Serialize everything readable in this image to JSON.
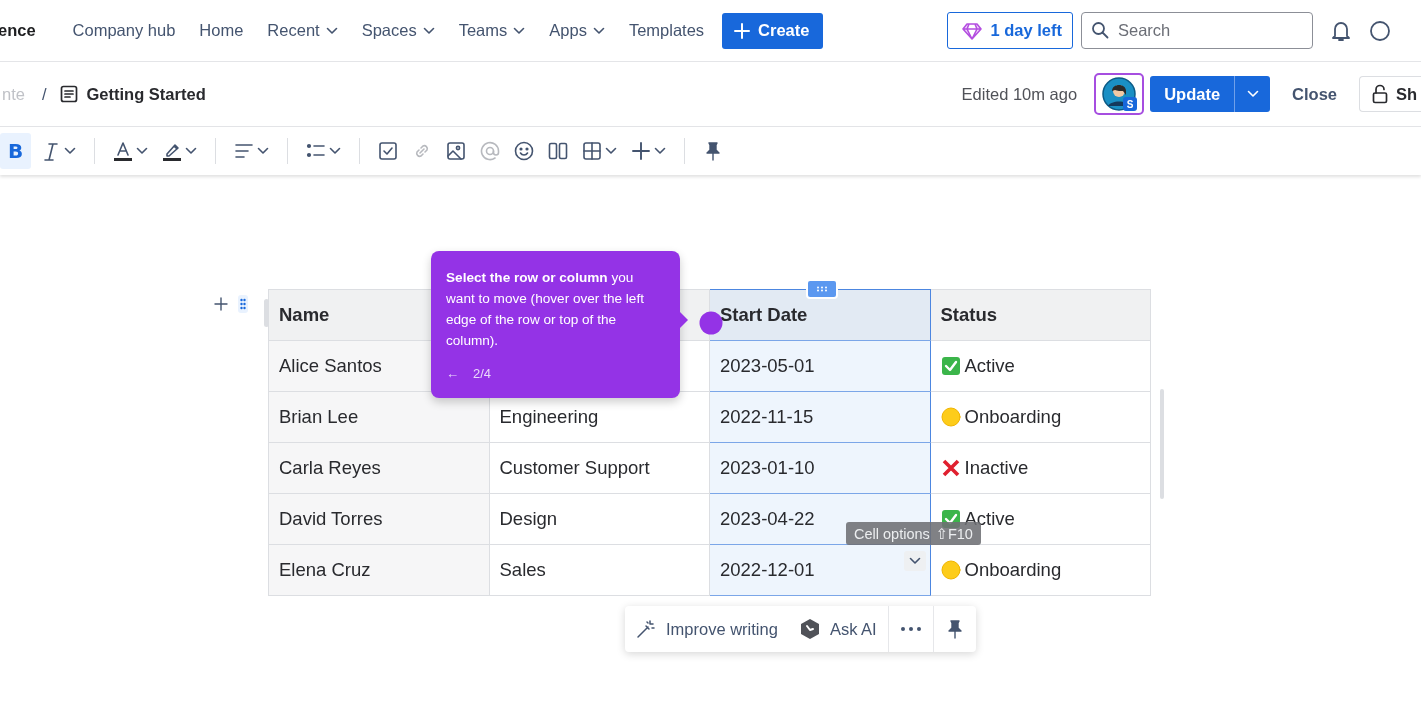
{
  "top_nav": {
    "logo_text": "ence",
    "links": [
      {
        "label": "Company hub",
        "dropdown": false
      },
      {
        "label": "Home",
        "dropdown": false
      },
      {
        "label": "Recent",
        "dropdown": true
      },
      {
        "label": "Spaces",
        "dropdown": true
      },
      {
        "label": "Teams",
        "dropdown": true
      },
      {
        "label": "Apps",
        "dropdown": true
      },
      {
        "label": "Templates",
        "dropdown": false
      }
    ],
    "create_button": "Create",
    "trial_button": "1 day left",
    "search": {
      "placeholder": "Search"
    }
  },
  "page_header": {
    "parent_crumb": "nte",
    "separator": "/",
    "title": "Getting Started",
    "edited": "Edited 10m ago",
    "avatar_badge": "S",
    "update_button": "Update",
    "close_button": "Close",
    "share_button": "Sh"
  },
  "toolbar": [
    {
      "kind": "bold",
      "label": "B",
      "active": true,
      "disabled": false,
      "dropdown": false
    },
    {
      "kind": "italic",
      "active": false,
      "disabled": false,
      "dropdown": true
    },
    {
      "kind": "separator"
    },
    {
      "kind": "text-color",
      "active": false,
      "disabled": false,
      "dropdown": true
    },
    {
      "kind": "highlight",
      "active": false,
      "disabled": false,
      "dropdown": true
    },
    {
      "kind": "separator"
    },
    {
      "kind": "align",
      "active": false,
      "disabled": false,
      "dropdown": true
    },
    {
      "kind": "separator"
    },
    {
      "kind": "list",
      "active": false,
      "disabled": false,
      "dropdown": true
    },
    {
      "kind": "separator"
    },
    {
      "kind": "task",
      "active": false,
      "disabled": false,
      "dropdown": false
    },
    {
      "kind": "link",
      "active": false,
      "disabled": true,
      "dropdown": false
    },
    {
      "kind": "image",
      "active": false,
      "disabled": false,
      "dropdown": false
    },
    {
      "kind": "mention",
      "active": false,
      "disabled": true,
      "dropdown": false
    },
    {
      "kind": "emoji",
      "active": false,
      "disabled": false,
      "dropdown": false
    },
    {
      "kind": "layout",
      "active": false,
      "disabled": false,
      "dropdown": false
    },
    {
      "kind": "table",
      "active": false,
      "disabled": false,
      "dropdown": true
    },
    {
      "kind": "insert",
      "active": false,
      "disabled": false,
      "dropdown": true
    },
    {
      "kind": "separator"
    },
    {
      "kind": "pin",
      "active": false,
      "disabled": false,
      "dropdown": false
    }
  ],
  "table": {
    "columns": [
      {
        "label": "Name",
        "selected": false
      },
      {
        "selected": false
      },
      {
        "label": "Start Date",
        "selected": true
      },
      {
        "label": "Status",
        "selected": false
      }
    ],
    "rows": [
      {
        "name": "Alice Santos",
        "start_date": "2023-05-01",
        "status": {
          "kind": "active",
          "text": "Active"
        },
        "cell_menu": false
      },
      {
        "name": "Brian Lee",
        "column_2": "Engineering",
        "start_date": "2022-11-15",
        "status": {
          "kind": "onboarding",
          "text": "Onboarding"
        },
        "cell_menu": false
      },
      {
        "name": "Carla Reyes",
        "column_2": "Customer Support",
        "start_date": "2023-01-10",
        "status": {
          "kind": "inactive",
          "text": "Inactive"
        },
        "cell_menu": false
      },
      {
        "name": "David Torres",
        "column_2": "Design",
        "start_date": "2023-04-22",
        "status": {
          "kind": "active",
          "text": "Active"
        },
        "cell_menu": false
      },
      {
        "name": "Elena Cruz",
        "column_2": "Sales",
        "start_date": "2022-12-01",
        "status": {
          "kind": "onboarding",
          "text": "Onboarding"
        },
        "cell_menu": true
      }
    ]
  },
  "guide_tooltip": {
    "text": "**Select the row or column** you want to move (hover over the left edge of the row or top of the column).",
    "back": "←",
    "step": "2/4"
  },
  "cell_options_tip": {
    "label": "Cell options",
    "shortcut": "⇧F10"
  },
  "ai_bar": {
    "improve": "Improve writing",
    "ask": "Ask AI"
  }
}
